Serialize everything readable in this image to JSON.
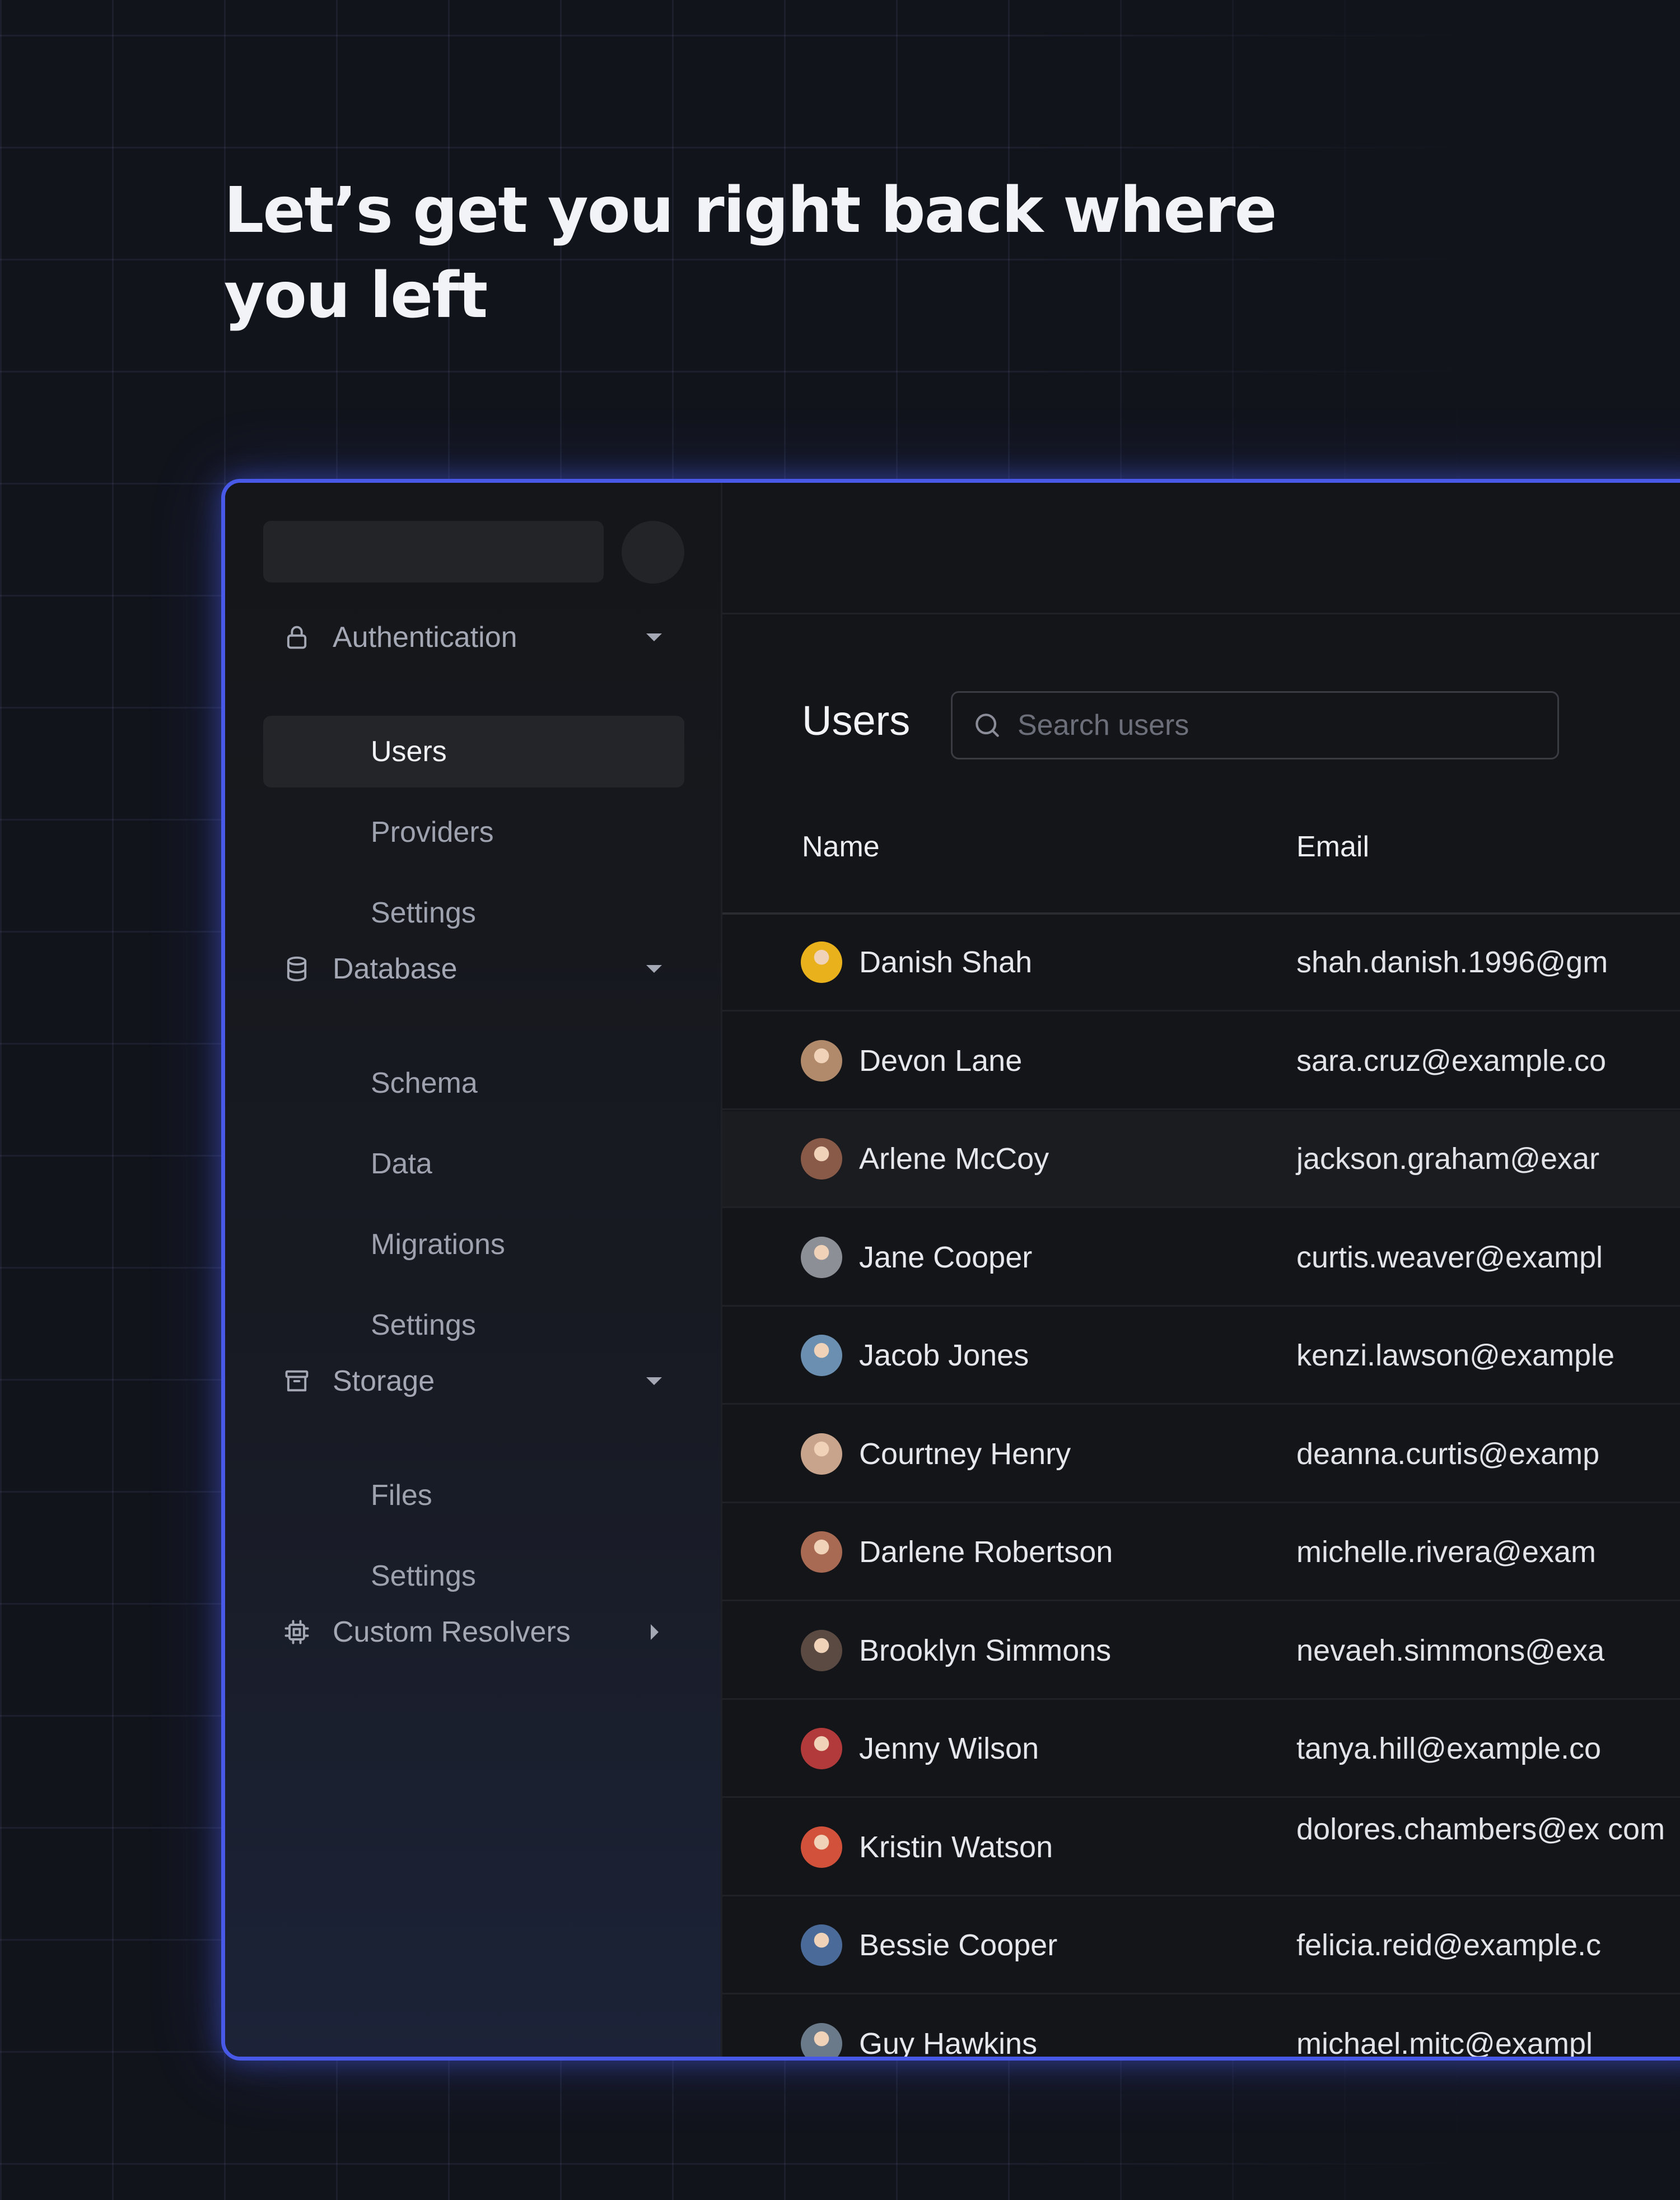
{
  "headline": "Let’s get you right back where you left",
  "sidebar": {
    "groups": [
      {
        "label": "Authentication",
        "icon": "lock-icon",
        "expanded": true,
        "items": [
          "Users",
          "Providers",
          "Settings"
        ],
        "active": "Users"
      },
      {
        "label": "Database",
        "icon": "database-icon",
        "expanded": true,
        "items": [
          "Schema",
          "Data",
          "Migrations",
          "Settings"
        ]
      },
      {
        "label": "Storage",
        "icon": "archive-box-icon",
        "expanded": true,
        "items": [
          "Files",
          "Settings"
        ]
      },
      {
        "label": "Custom Resolvers",
        "icon": "chip-icon",
        "expanded": false,
        "items": []
      }
    ]
  },
  "main": {
    "title": "Users",
    "search_placeholder": "Search users",
    "columns": [
      "Name",
      "Email"
    ],
    "rows": [
      {
        "name": "Danish Shah",
        "email": "shah.danish.1996@gm",
        "avatar_color": "#e9b21c"
      },
      {
        "name": "Devon Lane",
        "email": "sara.cruz@example.co",
        "avatar_color": "#b08a6a"
      },
      {
        "name": "Arlene McCoy",
        "email": "jackson.graham@exar",
        "avatar_color": "#8a5a48"
      },
      {
        "name": "Jane Cooper",
        "email": "curtis.weaver@exampl",
        "avatar_color": "#8c8f96"
      },
      {
        "name": "Jacob Jones",
        "email": "kenzi.lawson@example",
        "avatar_color": "#6a8fb0"
      },
      {
        "name": "Courtney Henry",
        "email": "deanna.curtis@examp",
        "avatar_color": "#c9a48c"
      },
      {
        "name": "Darlene Robertson",
        "email": "michelle.rivera@exam",
        "avatar_color": "#a86a52"
      },
      {
        "name": "Brooklyn Simmons",
        "email": "nevaeh.simmons@exa",
        "avatar_color": "#5a4a42"
      },
      {
        "name": "Jenny Wilson",
        "email": "tanya.hill@example.co",
        "avatar_color": "#b23a3a"
      },
      {
        "name": "Kristin Watson",
        "email": "dolores.chambers@ex com",
        "avatar_color": "#d2513a"
      },
      {
        "name": "Bessie Cooper",
        "email": "felicia.reid@example.c",
        "avatar_color": "#4a6a9a"
      },
      {
        "name": "Guy Hawkins",
        "email": "michael.mitc@exampl",
        "avatar_color": "#6a7a8a"
      }
    ]
  },
  "colors": {
    "accent": "#4759e6",
    "background": "#12141c",
    "sidebar_active": "#232528"
  }
}
